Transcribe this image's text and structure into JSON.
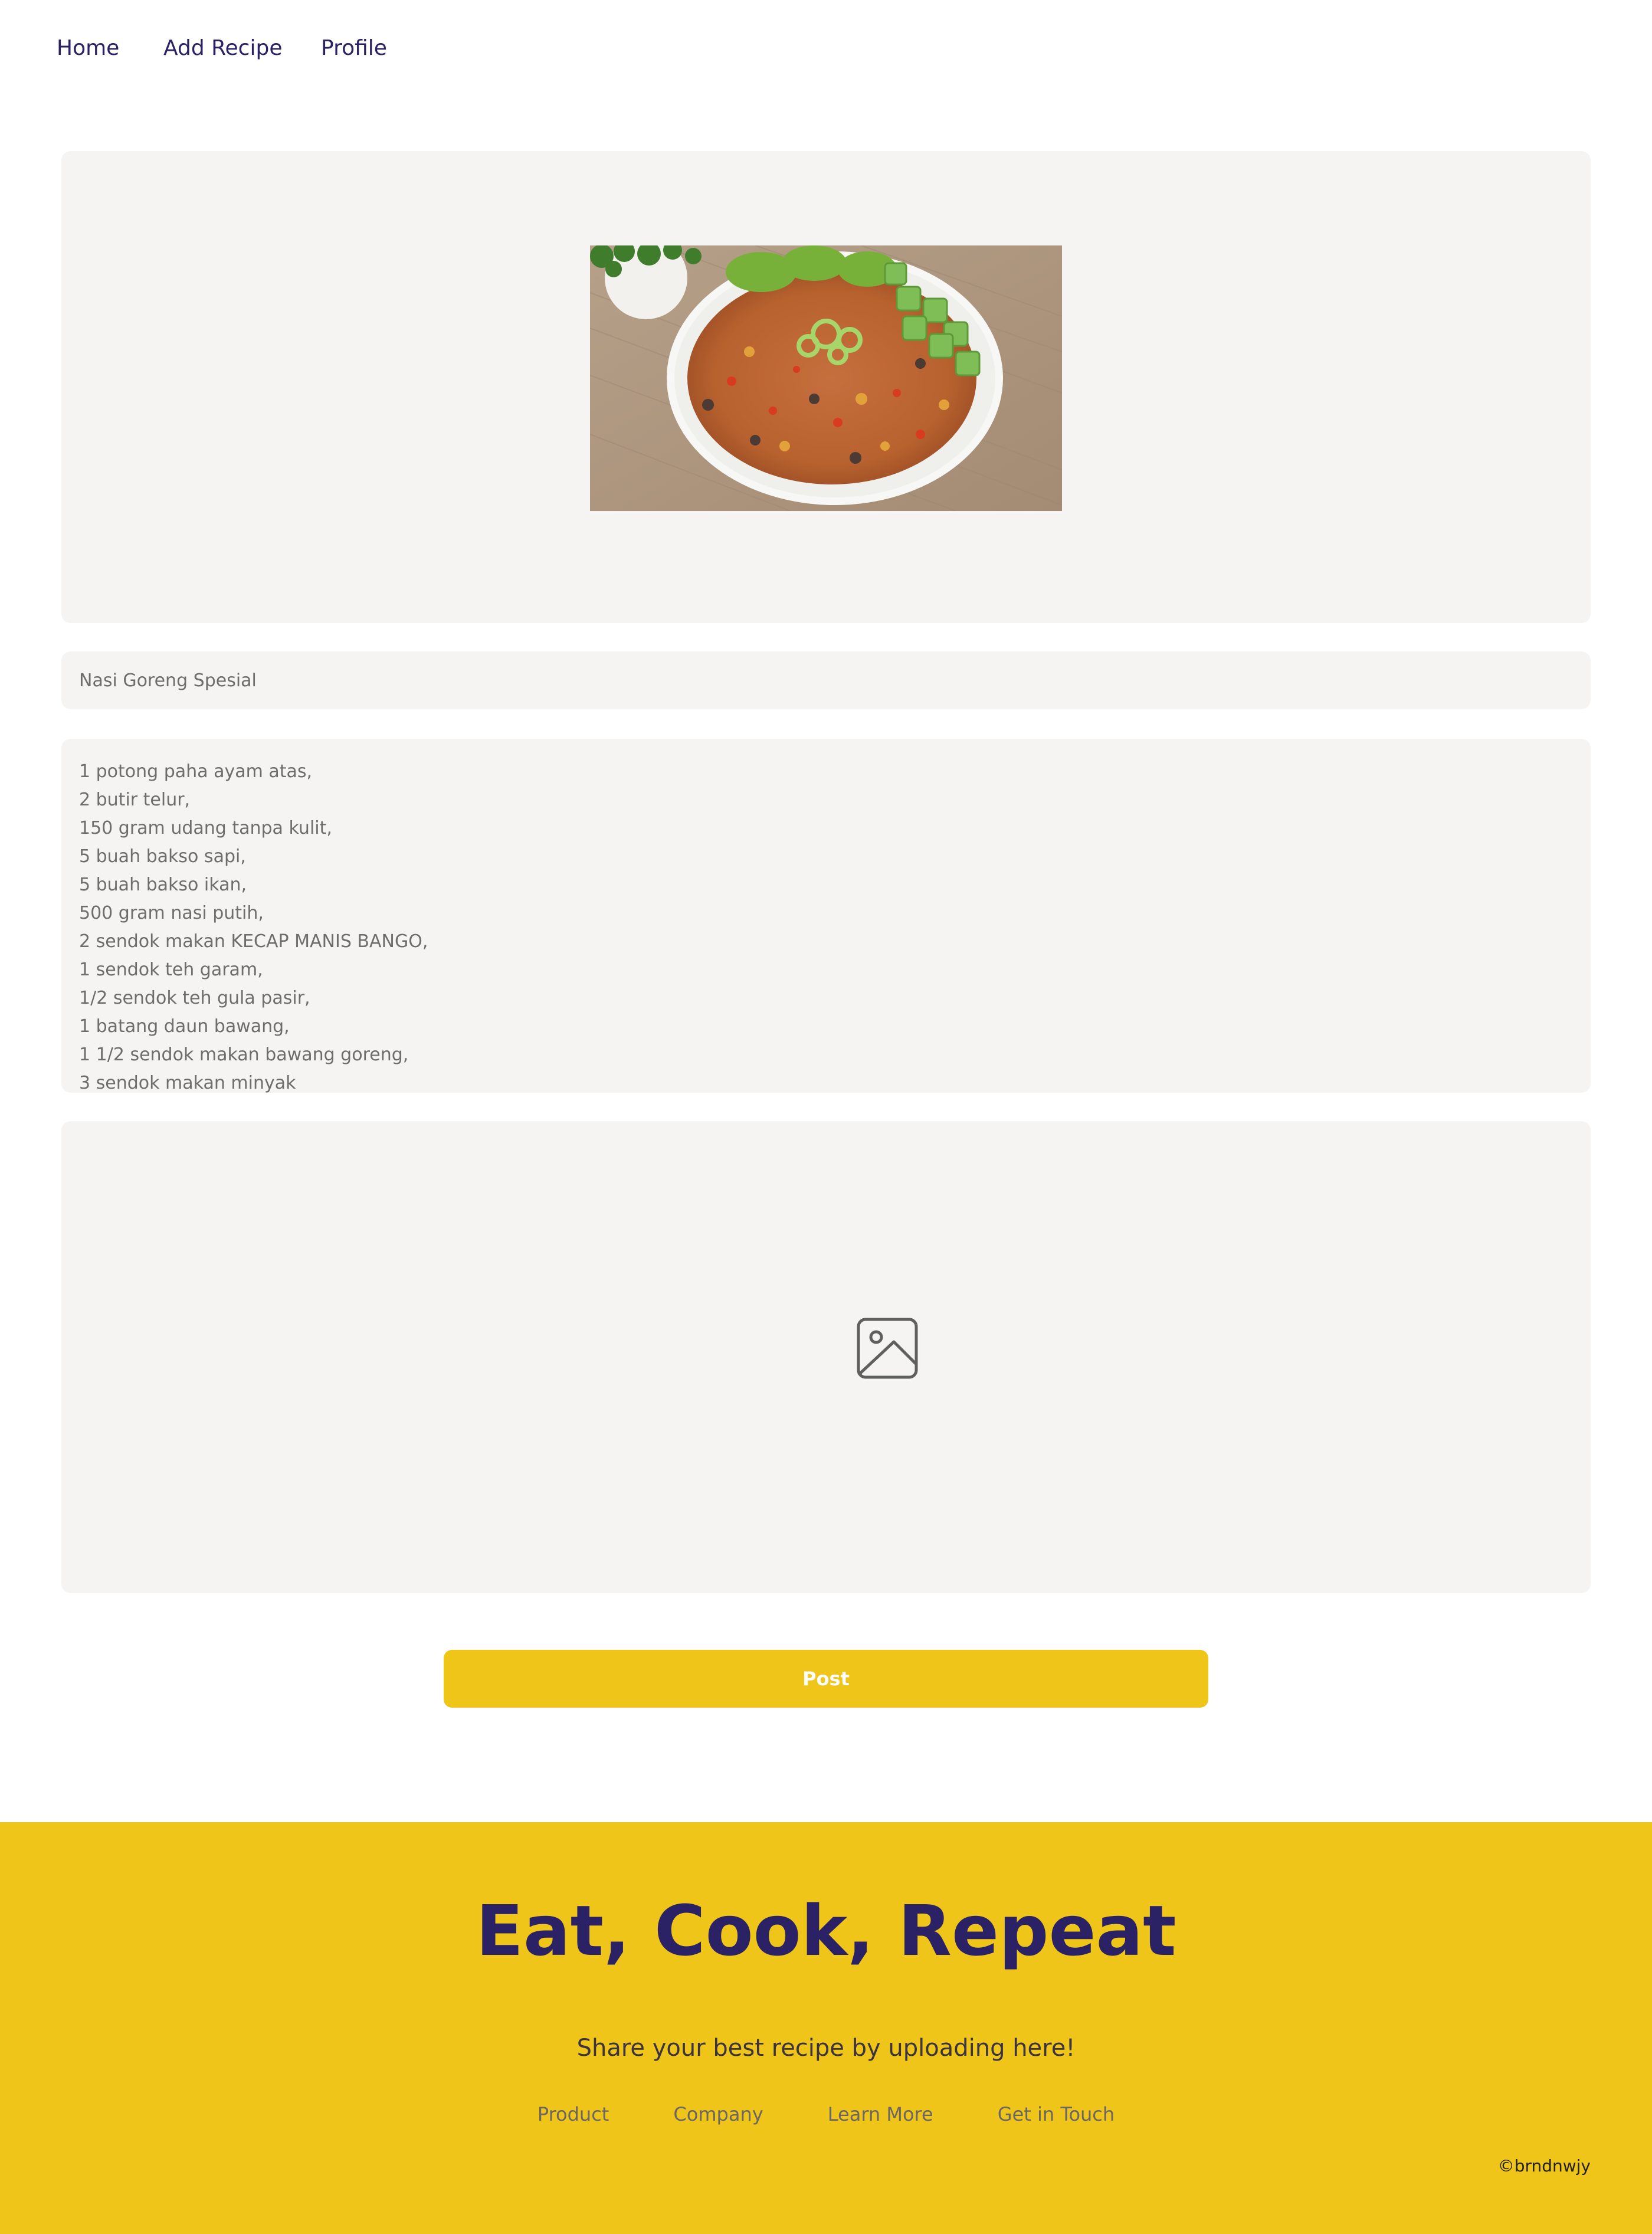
{
  "nav": {
    "home": "Home",
    "add_recipe": "Add Recipe",
    "profile": "Profile"
  },
  "form": {
    "recipe_title": "Nasi Goreng Spesial",
    "ingredients": "1 potong paha ayam atas,\n2 butir telur,\n150 gram udang tanpa kulit,\n5 buah bakso sapi,\n5 buah bakso ikan,\n500 gram nasi putih,\n2 sendok makan KECAP MANIS BANGO,\n1 sendok teh garam,\n1/2 sendok teh gula pasir,\n1 batang daun bawang,\n1 1/2 sendok makan bawang goreng,\n3 sendok makan minyak",
    "post_label": "Post",
    "upload_icon": "image-icon"
  },
  "footer": {
    "title": "Eat, Cook, Repeat",
    "subtitle": "Share your best recipe by uploading here!",
    "links": [
      "Product",
      "Company",
      "Learn More",
      "Get in Touch"
    ],
    "copyright": "©brndnwjy"
  },
  "colors": {
    "accent": "#efc519",
    "brand_text": "#2b2266",
    "panel": "#f5f4f2"
  }
}
